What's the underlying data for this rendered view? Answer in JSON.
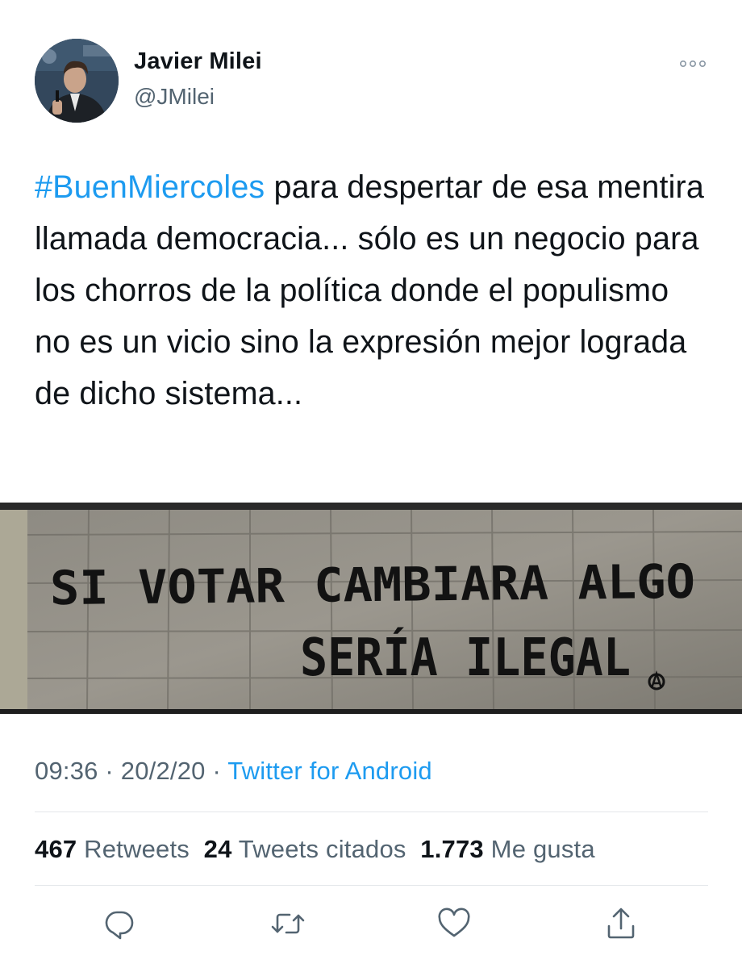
{
  "author": {
    "display_name": "Javier Milei",
    "handle": "@JMilei",
    "avatar_icon": "profile-photo"
  },
  "more_icon": "more-horizontal-icon",
  "tweet": {
    "hashtag": "#BuenMiercoles",
    "text": " para despertar de esa mentira llamada democracia... sólo es un negocio para los chorros de la política donde el populismo no es un vicio sino la expresión mejor lograda de dicho sistema..."
  },
  "media": {
    "graffiti_line1": "SI VOTAR CAMBIARA ALGO",
    "graffiti_line2": "SERÍA ILEGAL"
  },
  "meta": {
    "time": "09:36",
    "separator": "·",
    "date": "20/2/20",
    "source": "Twitter for Android"
  },
  "stats": {
    "retweets_count": "467",
    "retweets_label": "Retweets",
    "quotes_count": "24",
    "quotes_label": "Tweets citados",
    "likes_count": "1.773",
    "likes_label": "Me gusta"
  },
  "actions": [
    "reply-icon",
    "retweet-icon",
    "like-icon",
    "share-icon"
  ],
  "colors": {
    "link": "#1d9bf0",
    "secondary_text": "#536471",
    "primary_text": "#0f1419"
  }
}
